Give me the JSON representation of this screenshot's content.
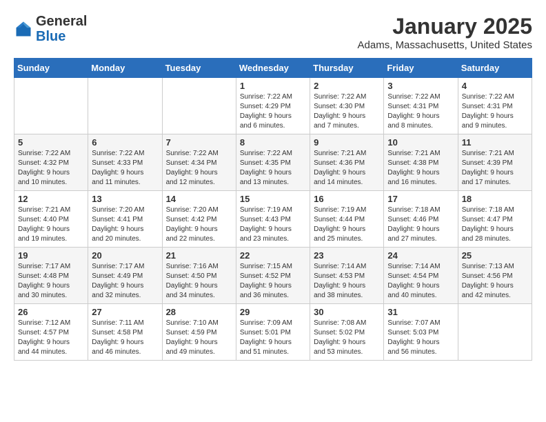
{
  "header": {
    "logo_general": "General",
    "logo_blue": "Blue",
    "month": "January 2025",
    "location": "Adams, Massachusetts, United States"
  },
  "weekdays": [
    "Sunday",
    "Monday",
    "Tuesday",
    "Wednesday",
    "Thursday",
    "Friday",
    "Saturday"
  ],
  "weeks": [
    [
      {
        "day": "",
        "info": ""
      },
      {
        "day": "",
        "info": ""
      },
      {
        "day": "",
        "info": ""
      },
      {
        "day": "1",
        "info": "Sunrise: 7:22 AM\nSunset: 4:29 PM\nDaylight: 9 hours\nand 6 minutes."
      },
      {
        "day": "2",
        "info": "Sunrise: 7:22 AM\nSunset: 4:30 PM\nDaylight: 9 hours\nand 7 minutes."
      },
      {
        "day": "3",
        "info": "Sunrise: 7:22 AM\nSunset: 4:31 PM\nDaylight: 9 hours\nand 8 minutes."
      },
      {
        "day": "4",
        "info": "Sunrise: 7:22 AM\nSunset: 4:31 PM\nDaylight: 9 hours\nand 9 minutes."
      }
    ],
    [
      {
        "day": "5",
        "info": "Sunrise: 7:22 AM\nSunset: 4:32 PM\nDaylight: 9 hours\nand 10 minutes."
      },
      {
        "day": "6",
        "info": "Sunrise: 7:22 AM\nSunset: 4:33 PM\nDaylight: 9 hours\nand 11 minutes."
      },
      {
        "day": "7",
        "info": "Sunrise: 7:22 AM\nSunset: 4:34 PM\nDaylight: 9 hours\nand 12 minutes."
      },
      {
        "day": "8",
        "info": "Sunrise: 7:22 AM\nSunset: 4:35 PM\nDaylight: 9 hours\nand 13 minutes."
      },
      {
        "day": "9",
        "info": "Sunrise: 7:21 AM\nSunset: 4:36 PM\nDaylight: 9 hours\nand 14 minutes."
      },
      {
        "day": "10",
        "info": "Sunrise: 7:21 AM\nSunset: 4:38 PM\nDaylight: 9 hours\nand 16 minutes."
      },
      {
        "day": "11",
        "info": "Sunrise: 7:21 AM\nSunset: 4:39 PM\nDaylight: 9 hours\nand 17 minutes."
      }
    ],
    [
      {
        "day": "12",
        "info": "Sunrise: 7:21 AM\nSunset: 4:40 PM\nDaylight: 9 hours\nand 19 minutes."
      },
      {
        "day": "13",
        "info": "Sunrise: 7:20 AM\nSunset: 4:41 PM\nDaylight: 9 hours\nand 20 minutes."
      },
      {
        "day": "14",
        "info": "Sunrise: 7:20 AM\nSunset: 4:42 PM\nDaylight: 9 hours\nand 22 minutes."
      },
      {
        "day": "15",
        "info": "Sunrise: 7:19 AM\nSunset: 4:43 PM\nDaylight: 9 hours\nand 23 minutes."
      },
      {
        "day": "16",
        "info": "Sunrise: 7:19 AM\nSunset: 4:44 PM\nDaylight: 9 hours\nand 25 minutes."
      },
      {
        "day": "17",
        "info": "Sunrise: 7:18 AM\nSunset: 4:46 PM\nDaylight: 9 hours\nand 27 minutes."
      },
      {
        "day": "18",
        "info": "Sunrise: 7:18 AM\nSunset: 4:47 PM\nDaylight: 9 hours\nand 28 minutes."
      }
    ],
    [
      {
        "day": "19",
        "info": "Sunrise: 7:17 AM\nSunset: 4:48 PM\nDaylight: 9 hours\nand 30 minutes."
      },
      {
        "day": "20",
        "info": "Sunrise: 7:17 AM\nSunset: 4:49 PM\nDaylight: 9 hours\nand 32 minutes."
      },
      {
        "day": "21",
        "info": "Sunrise: 7:16 AM\nSunset: 4:50 PM\nDaylight: 9 hours\nand 34 minutes."
      },
      {
        "day": "22",
        "info": "Sunrise: 7:15 AM\nSunset: 4:52 PM\nDaylight: 9 hours\nand 36 minutes."
      },
      {
        "day": "23",
        "info": "Sunrise: 7:14 AM\nSunset: 4:53 PM\nDaylight: 9 hours\nand 38 minutes."
      },
      {
        "day": "24",
        "info": "Sunrise: 7:14 AM\nSunset: 4:54 PM\nDaylight: 9 hours\nand 40 minutes."
      },
      {
        "day": "25",
        "info": "Sunrise: 7:13 AM\nSunset: 4:56 PM\nDaylight: 9 hours\nand 42 minutes."
      }
    ],
    [
      {
        "day": "26",
        "info": "Sunrise: 7:12 AM\nSunset: 4:57 PM\nDaylight: 9 hours\nand 44 minutes."
      },
      {
        "day": "27",
        "info": "Sunrise: 7:11 AM\nSunset: 4:58 PM\nDaylight: 9 hours\nand 46 minutes."
      },
      {
        "day": "28",
        "info": "Sunrise: 7:10 AM\nSunset: 4:59 PM\nDaylight: 9 hours\nand 49 minutes."
      },
      {
        "day": "29",
        "info": "Sunrise: 7:09 AM\nSunset: 5:01 PM\nDaylight: 9 hours\nand 51 minutes."
      },
      {
        "day": "30",
        "info": "Sunrise: 7:08 AM\nSunset: 5:02 PM\nDaylight: 9 hours\nand 53 minutes."
      },
      {
        "day": "31",
        "info": "Sunrise: 7:07 AM\nSunset: 5:03 PM\nDaylight: 9 hours\nand 56 minutes."
      },
      {
        "day": "",
        "info": ""
      }
    ]
  ]
}
